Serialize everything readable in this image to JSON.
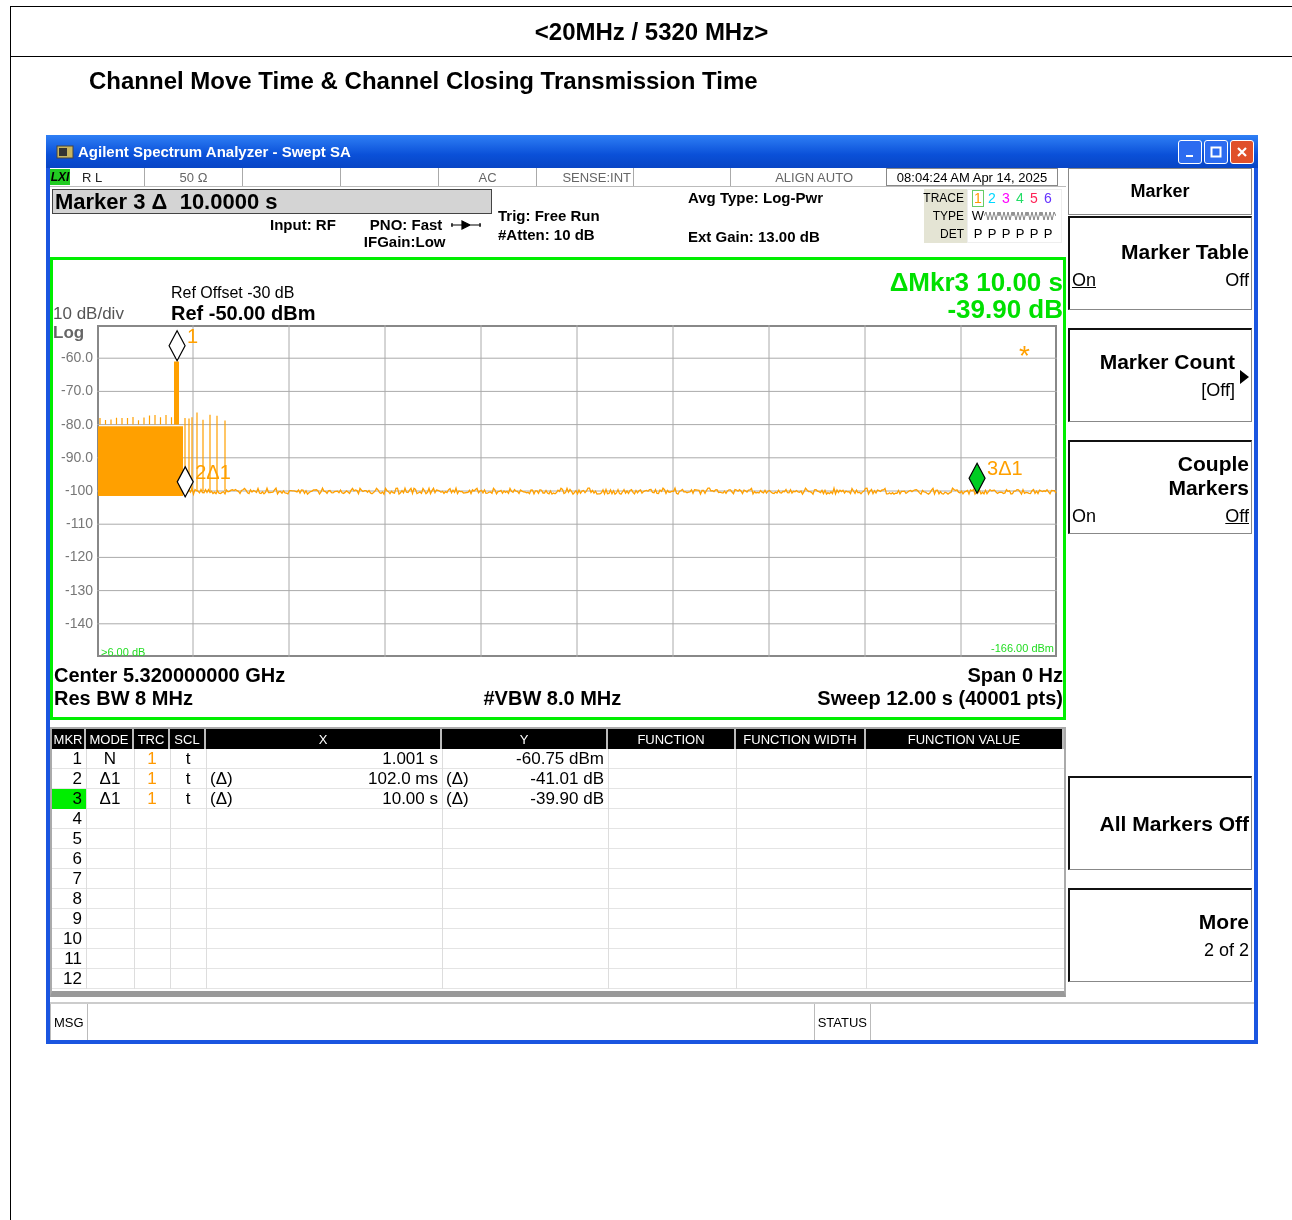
{
  "document": {
    "header": "<20MHz / 5320 MHz>",
    "title": "Channel Move Time & Channel Closing Transmission Time"
  },
  "window": {
    "title": "Agilent Spectrum Analyzer - Swept SA"
  },
  "status_line": {
    "badge": "LXI",
    "cells": [
      {
        "kind": "text",
        "text": "R L"
      },
      {
        "kind": "text",
        "text": "50 Ω"
      },
      {
        "kind": "blank"
      },
      {
        "kind": "blank"
      },
      {
        "kind": "text",
        "text": "AC"
      },
      {
        "kind": "text",
        "text": "SENSE:INT"
      },
      {
        "kind": "blank"
      },
      {
        "kind": "text",
        "text": "ALIGN AUTO"
      },
      {
        "kind": "clock",
        "text": "08:04:24 AM Apr 14, 2025"
      }
    ]
  },
  "settings": {
    "marker_readout": "Marker 3 Δ  10.0000 s",
    "input": "Input: RF",
    "pno": "PNO: Fast",
    "ifgain": "IFGain:Low",
    "trig": "Trig: Free Run",
    "atten": "#Atten: 10 dB",
    "avg_type": "Avg Type: Log-Pwr",
    "ext_gain": "Ext Gain: 13.00 dB"
  },
  "trace_panel": {
    "trace_label": "TRACE",
    "type_label": "TYPE",
    "det_label": "DET",
    "traces": [
      {
        "number": "1",
        "color": "#ff9900",
        "type": "W",
        "det": "P",
        "selected": true
      },
      {
        "number": "2",
        "color": "#00d8ff",
        "det": "P",
        "selected": false
      },
      {
        "number": "3",
        "color": "#ff00ff",
        "det": "P",
        "selected": false
      },
      {
        "number": "4",
        "color": "#22dd66",
        "det": "P",
        "selected": false
      },
      {
        "number": "5",
        "color": "#ff2255",
        "det": "P",
        "selected": false
      },
      {
        "number": "6",
        "color": "#6633ff",
        "det": "P",
        "selected": false
      }
    ]
  },
  "graph": {
    "ref_offset": "Ref Offset -30 dB",
    "ref": "Ref -50.00 dBm",
    "scale": "10 dB/div",
    "scale_type": "Log",
    "delta_readout": [
      "ΔMkr3 10.00 s",
      "-39.90 dB"
    ],
    "y_labels": [
      "-60.0",
      "-70.0",
      "-80.0",
      "-90.0",
      "-100",
      "-110",
      "-120",
      "-130",
      "-140"
    ],
    "threshold_left": ">6.00 dB",
    "threshold_right": "-166.00 dBm",
    "sweep_mark": "*",
    "markers": [
      {
        "label": "1",
        "selected": false
      },
      {
        "label": "2Δ1",
        "selected": false
      },
      {
        "label": "3Δ1",
        "selected": true
      }
    ],
    "center": "Center 5.320000000 GHz",
    "span": "Span 0 Hz",
    "res_bw": "Res BW 8 MHz",
    "vbw": "#VBW 8.0 MHz",
    "sweep": "Sweep  12.00 s (40001 pts)"
  },
  "marker_table": {
    "columns": [
      "MKR",
      "MODE",
      "TRC",
      "SCL",
      "X",
      "Y",
      "FUNCTION",
      "FUNCTION WIDTH",
      "FUNCTION VALUE"
    ],
    "rows": [
      {
        "mkr": "1",
        "mode": "N",
        "trc": "1",
        "scl": "t",
        "x": "1.001 s",
        "y": "-60.75 dBm",
        "selected": false
      },
      {
        "mkr": "2",
        "mode": "Δ1",
        "trc": "1",
        "scl": "t",
        "x_prefix": "(Δ)",
        "x": "102.0 ms",
        "y_prefix": "(Δ)",
        "y": "-41.01 dB",
        "selected": false
      },
      {
        "mkr": "3",
        "mode": "Δ1",
        "trc": "1",
        "scl": "t",
        "x_prefix": "(Δ)",
        "x": "10.00 s",
        "y_prefix": "(Δ)",
        "y": "-39.90 dB",
        "selected": true
      },
      {
        "mkr": "4",
        "selected": false
      },
      {
        "mkr": "5",
        "selected": false
      },
      {
        "mkr": "6",
        "selected": false
      },
      {
        "mkr": "7",
        "selected": false
      },
      {
        "mkr": "8",
        "selected": false
      },
      {
        "mkr": "9",
        "selected": false
      },
      {
        "mkr": "10",
        "selected": false
      },
      {
        "mkr": "11",
        "selected": false
      },
      {
        "mkr": "12",
        "selected": false
      }
    ]
  },
  "softkeys": [
    {
      "kind": "title",
      "label": "Marker"
    },
    {
      "kind": "toggle",
      "label": "Marker Table",
      "options": [
        {
          "text": "On",
          "selected": true
        },
        {
          "text": "Off",
          "selected": false
        }
      ]
    },
    {
      "kind": "submenu",
      "label": "Marker Count",
      "value": "[Off]"
    },
    {
      "kind": "toggle",
      "label": "Couple Markers",
      "options": [
        {
          "text": "On",
          "selected": false
        },
        {
          "text": "Off",
          "selected": true
        }
      ]
    },
    {
      "kind": "blank"
    },
    {
      "kind": "blank"
    },
    {
      "kind": "action",
      "label": "All Markers Off"
    },
    {
      "kind": "more",
      "label": "More",
      "value": "2 of 2"
    }
  ],
  "status_bar": {
    "msg": "MSG",
    "status": "STATUS"
  }
}
